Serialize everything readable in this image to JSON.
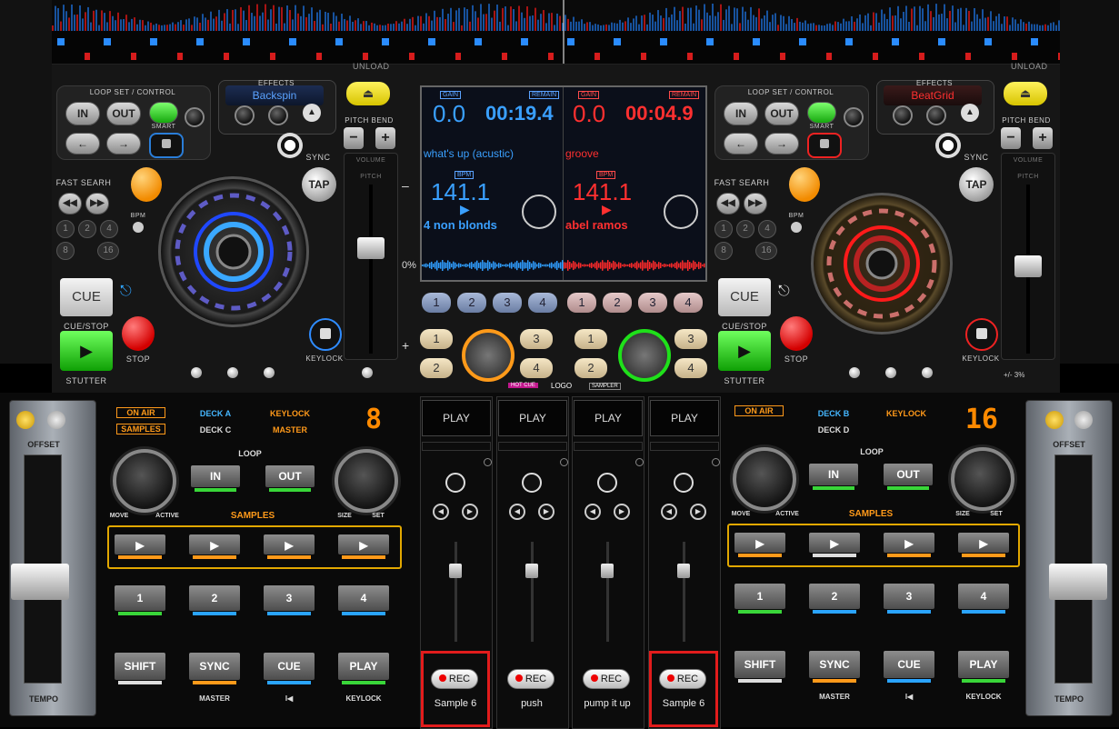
{
  "deck_a": {
    "loop_title": "LOOP SET / CONTROL",
    "in_label": "IN",
    "out_label": "OUT",
    "smart_label": "SMART",
    "effects_title": "EFFECTS",
    "effect": "Backspin",
    "pitch_bend_label": "PITCH BEND",
    "sync_label": "SYNC",
    "tap_label": "TAP",
    "fast_search_label": "FAST SEARH",
    "bpm_small": "BPM",
    "cue_label": "CUE",
    "cue_stop_label": "CUE/STOP",
    "stutter_label": "STUTTER",
    "stop_label": "STOP",
    "keylock_label": "KEYLOCK",
    "loop_nums": [
      "1",
      "2",
      "4",
      "8",
      "16"
    ],
    "unload_label": "UNLOAD",
    "gain_tag": "GAIN",
    "remain_tag": "REMAIN",
    "gain": "0.0",
    "remain": "00:19.4",
    "track": "what's up (acustic)",
    "bpm_tag": "BPM",
    "bpm": "141.1",
    "artist": "4 non blonds",
    "pitch_pct": "0%",
    "color": "#2f8cff"
  },
  "deck_b": {
    "loop_title": "LOOP SET / CONTROL",
    "in_label": "IN",
    "out_label": "OUT",
    "smart_label": "SMART",
    "effects_title": "EFFECTS",
    "effect": "BeatGrid",
    "pitch_bend_label": "PITCH BEND",
    "sync_label": "SYNC",
    "tap_label": "TAP",
    "fast_search_label": "FAST SEARH",
    "bpm_small": "BPM",
    "cue_label": "CUE",
    "cue_stop_label": "CUE/STOP",
    "stutter_label": "STUTTER",
    "stop_label": "STOP",
    "keylock_label": "KEYLOCK",
    "loop_nums": [
      "1",
      "2",
      "4",
      "8",
      "16"
    ],
    "unload_label": "UNLOAD",
    "gain_tag": "GAIN",
    "remain_tag": "REMAIN",
    "gain": "0.0",
    "remain": "00:04.9",
    "track": "groove",
    "bpm_tag": "BPM",
    "bpm": "141.1",
    "artist": "abel ramos",
    "pitch_pct": "+/- 3%",
    "color": "#ff2a2a"
  },
  "pitch_panel": {
    "volume": "VOLUME",
    "pitch": "PITCH"
  },
  "hotcues": [
    "1",
    "2",
    "3",
    "4"
  ],
  "samplers_left": [
    "1",
    "2",
    "3",
    "4"
  ],
  "samplers_right": [
    "1",
    "2",
    "3",
    "4"
  ],
  "footer_tags": {
    "hot_cue": "HOT CUE",
    "logo": "LOGO",
    "sampler": "SAMPLER"
  },
  "controller_left": {
    "offset": "OFFSET",
    "tempo": "TEMPO",
    "on_air": "ON AIR",
    "samples_tag": "SAMPLES",
    "deck_a": "DECK A",
    "deck_c": "DECK C",
    "keylock": "KEYLOCK",
    "master": "MASTER",
    "number": "8",
    "loop": "LOOP",
    "in": "IN",
    "out": "OUT",
    "move": "MOVE",
    "active": "ACTIVE",
    "size": "SIZE",
    "set": "SET",
    "samples": "SAMPLES",
    "pads": [
      "1",
      "2",
      "3",
      "4"
    ],
    "shift": "SHIFT",
    "sync": "SYNC",
    "cue": "CUE",
    "play": "PLAY",
    "sync_sub": "MASTER",
    "cue_sub": "I◀",
    "play_sub": "KEYLOCK"
  },
  "controller_right": {
    "offset": "OFFSET",
    "tempo": "TEMPO",
    "on_air": "ON AIR",
    "deck_b": "DECK B",
    "deck_d": "DECK D",
    "keylock": "KEYLOCK",
    "number": "16",
    "loop": "LOOP",
    "in": "IN",
    "out": "OUT",
    "move": "MOVE",
    "active": "ACTIVE",
    "size": "SIZE",
    "set": "SET",
    "samples": "SAMPLES",
    "pads": [
      "1",
      "2",
      "3",
      "4"
    ],
    "shift": "SHIFT",
    "sync": "SYNC",
    "cue": "CUE",
    "play": "PLAY",
    "sync_sub": "MASTER",
    "cue_sub": "I◀",
    "play_sub": "KEYLOCK"
  },
  "sampler_channels": [
    {
      "play": "PLAY",
      "rec": "REC",
      "name": "Sample 6",
      "highlighted": true
    },
    {
      "play": "PLAY",
      "rec": "REC",
      "name": "push",
      "highlighted": false
    },
    {
      "play": "PLAY",
      "rec": "REC",
      "name": "pump it up",
      "highlighted": false
    },
    {
      "play": "PLAY",
      "rec": "REC",
      "name": "Sample 6",
      "highlighted": true
    }
  ]
}
